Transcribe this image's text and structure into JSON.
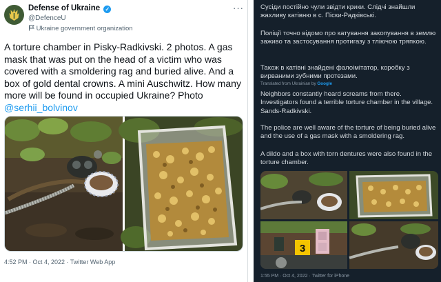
{
  "left_tweet": {
    "author_name": "Defense of Ukraine",
    "handle": "@DefenceU",
    "affiliation": "Ukraine government organization",
    "text": "A torture chamber in Pisky-Radkivski. 2 photos. A gas mask that was put on the head of a victim who was covered with a smoldering rag and buried alive. And a box of gold dental crowns. A mini Auschwitz. How many more will be found in occupied Ukraine? Photo ",
    "mention": "@serhii_bolvinov",
    "timestamp": "4:52 PM · Oct 4, 2022 · Twitter Web App",
    "photo_count": 2
  },
  "right_tweet": {
    "original_p1": "Сусіди постійно чули звідти крики. Слідчі знайшли жахливу катівню в с. Піски-Радківські.",
    "original_p2": "Поліції точно відомо про катування закопування в землю заживо та застосування протигазу з тліючою тряпкою.",
    "original_p3": "Також в катівні знайдені фалоімітатор, коробку з вирваними зубними протезами.",
    "translated_by_prefix": "Translated from Ukrainian by ",
    "translated_by_service": "Google",
    "translation_p1": "Neighbors constantly heard screams from there. Investigators found a terrible torture chamber in the village. Sands-Radkivski.",
    "translation_p2": "The police are well aware of the torture of being buried alive and the use of a gas mask with a smoldering rag.",
    "translation_p3": "A dildo and a box with torn dentures were also found in the torture chamber.",
    "evidence_marker": "3",
    "timestamp": "1:55 PM · Oct 4, 2022 · Twitter for iPhone"
  },
  "colors": {
    "verified_blue": "#1d9bf0",
    "dark_background": "#15202b",
    "evidence_marker": "#f5c400"
  }
}
